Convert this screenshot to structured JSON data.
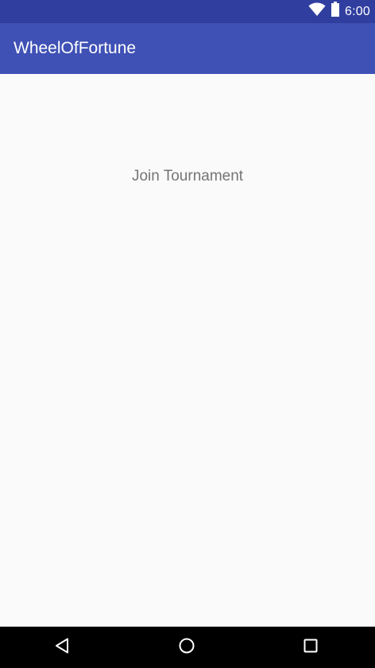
{
  "status_bar": {
    "time": "6:00",
    "icons": [
      "wifi-icon",
      "battery-icon"
    ]
  },
  "app_bar": {
    "title": "WheelOfFortune"
  },
  "main": {
    "join_label": "Join Tournament"
  },
  "nav_bar": {
    "buttons": [
      "back-icon",
      "home-icon",
      "recents-icon"
    ]
  },
  "colors": {
    "status_bar": "#303f9f",
    "app_bar": "#3f51b5",
    "background": "#fafafa",
    "text_secondary": "#757575",
    "nav_bar": "#000000"
  }
}
